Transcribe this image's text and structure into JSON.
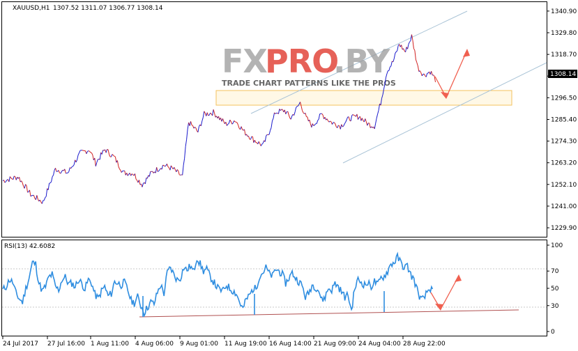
{
  "chart_data": [
    {
      "type": "candlestick",
      "symbol": "XAUUSD,H1",
      "ohlc_header": "1307.52 1311.07 1306.77 1308.14",
      "ylim": [
        1226,
        1343
      ],
      "yticks": [
        "1340.90",
        "1329.80",
        "1318.70",
        "1307.60",
        "1296.50",
        "1285.40",
        "1274.30",
        "1263.20",
        "1252.10",
        "1241.00",
        "1229.90"
      ],
      "current_price": "1308.14",
      "xticks": [
        "24 Jul 2017",
        "27 Jul 16:00",
        "1 Aug 11:00",
        "4 Aug 06:00",
        "9 Aug 01:00",
        "11 Aug 19:00",
        "16 Aug 14:00",
        "21 Aug 09:00",
        "24 Aug 04:00",
        "28 Aug 22:00"
      ],
      "price_path": [
        [
          0,
          1254
        ],
        [
          5,
          1256
        ],
        [
          9,
          1247
        ],
        [
          13,
          1243
        ],
        [
          17,
          1260
        ],
        [
          21,
          1258
        ],
        [
          25,
          1268
        ],
        [
          28,
          1270
        ],
        [
          30,
          1263
        ],
        [
          33,
          1270
        ],
        [
          36,
          1266
        ],
        [
          39,
          1258
        ],
        [
          42,
          1258
        ],
        [
          45,
          1252
        ],
        [
          48,
          1258
        ],
        [
          52,
          1262
        ],
        [
          55,
          1260
        ],
        [
          58,
          1256
        ],
        [
          60,
          1284
        ],
        [
          63,
          1279
        ],
        [
          65,
          1288
        ],
        [
          68,
          1289
        ],
        [
          72,
          1283
        ],
        [
          75,
          1285
        ],
        [
          78,
          1279
        ],
        [
          81,
          1275
        ],
        [
          84,
          1272
        ],
        [
          86,
          1279
        ],
        [
          88,
          1289
        ],
        [
          91,
          1290
        ],
        [
          93,
          1286
        ],
        [
          96,
          1294
        ],
        [
          98,
          1286
        ],
        [
          100,
          1282
        ],
        [
          103,
          1288
        ],
        [
          106,
          1284
        ],
        [
          109,
          1282
        ],
        [
          112,
          1286
        ],
        [
          115,
          1287
        ],
        [
          118,
          1283
        ],
        [
          120,
          1282
        ],
        [
          122,
          1294
        ],
        [
          124,
          1310
        ],
        [
          126,
          1315
        ],
        [
          128,
          1324
        ],
        [
          130,
          1320
        ],
        [
          132,
          1328
        ],
        [
          134,
          1312
        ],
        [
          136,
          1308
        ],
        [
          138,
          1310
        ],
        [
          140,
          1305
        ]
      ],
      "brand": "FXPRO.BY",
      "tagline": "TRADE CHART PATTERNS LIKE THE PROS"
    },
    {
      "type": "line",
      "name": "RSI(13) 42.6082",
      "ylim": [
        0,
        100
      ],
      "yticks": [
        "100",
        "70",
        "50",
        "30",
        "0"
      ],
      "values": [
        48,
        52,
        60,
        57,
        44,
        38,
        34,
        50,
        62,
        80,
        78,
        56,
        47,
        52,
        63,
        66,
        52,
        48,
        60,
        63,
        55,
        56,
        52,
        60,
        56,
        49,
        60,
        56,
        43,
        38,
        47,
        52,
        41,
        44,
        58,
        56,
        54,
        57,
        48,
        36,
        33,
        40,
        30,
        22,
        28,
        34,
        32,
        45,
        54,
        44,
        68,
        74,
        66,
        60,
        62,
        74,
        71,
        76,
        69,
        86,
        78,
        70,
        72,
        64,
        58,
        52,
        48,
        47,
        54,
        50,
        47,
        44,
        34,
        26,
        37,
        42,
        49,
        50,
        64,
        68,
        74,
        67,
        64,
        72,
        70,
        66,
        56,
        62,
        68,
        62,
        58,
        53,
        40,
        44,
        54,
        52,
        48,
        36,
        40,
        50,
        48,
        56,
        52,
        46,
        40,
        42,
        24,
        50,
        60,
        57,
        54,
        56,
        52,
        58,
        54,
        62,
        64,
        70,
        78,
        80,
        86,
        80,
        74,
        76,
        66,
        60,
        48,
        38,
        37,
        46,
        50,
        44
      ]
    }
  ]
}
